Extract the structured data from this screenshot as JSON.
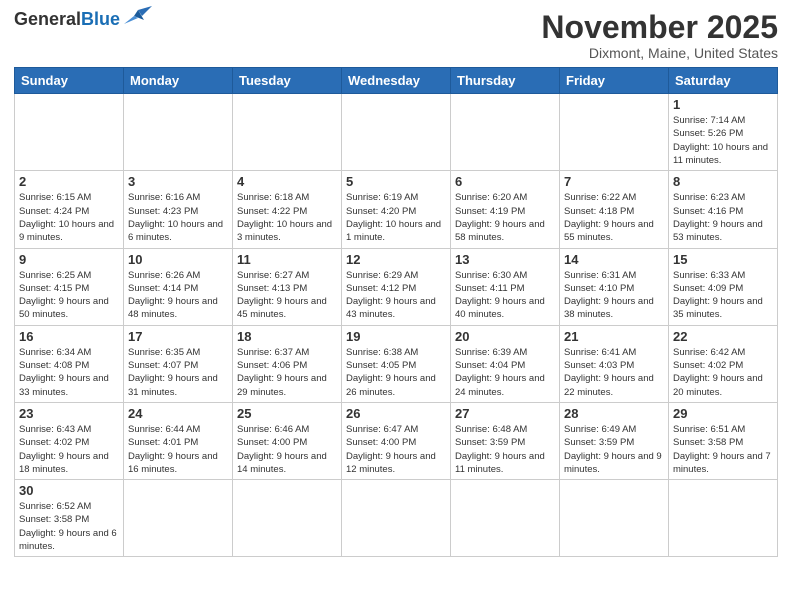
{
  "header": {
    "logo_general": "General",
    "logo_blue": "Blue",
    "month_title": "November 2025",
    "location": "Dixmont, Maine, United States"
  },
  "weekdays": [
    "Sunday",
    "Monday",
    "Tuesday",
    "Wednesday",
    "Thursday",
    "Friday",
    "Saturday"
  ],
  "days": [
    {
      "date": "",
      "info": ""
    },
    {
      "date": "",
      "info": ""
    },
    {
      "date": "",
      "info": ""
    },
    {
      "date": "",
      "info": ""
    },
    {
      "date": "",
      "info": ""
    },
    {
      "date": "",
      "info": ""
    },
    {
      "date": "1",
      "info": "Sunrise: 7:14 AM\nSunset: 5:26 PM\nDaylight: 10 hours and 11 minutes."
    },
    {
      "date": "2",
      "info": "Sunrise: 6:15 AM\nSunset: 4:24 PM\nDaylight: 10 hours and 9 minutes."
    },
    {
      "date": "3",
      "info": "Sunrise: 6:16 AM\nSunset: 4:23 PM\nDaylight: 10 hours and 6 minutes."
    },
    {
      "date": "4",
      "info": "Sunrise: 6:18 AM\nSunset: 4:22 PM\nDaylight: 10 hours and 3 minutes."
    },
    {
      "date": "5",
      "info": "Sunrise: 6:19 AM\nSunset: 4:20 PM\nDaylight: 10 hours and 1 minute."
    },
    {
      "date": "6",
      "info": "Sunrise: 6:20 AM\nSunset: 4:19 PM\nDaylight: 9 hours and 58 minutes."
    },
    {
      "date": "7",
      "info": "Sunrise: 6:22 AM\nSunset: 4:18 PM\nDaylight: 9 hours and 55 minutes."
    },
    {
      "date": "8",
      "info": "Sunrise: 6:23 AM\nSunset: 4:16 PM\nDaylight: 9 hours and 53 minutes."
    },
    {
      "date": "9",
      "info": "Sunrise: 6:25 AM\nSunset: 4:15 PM\nDaylight: 9 hours and 50 minutes."
    },
    {
      "date": "10",
      "info": "Sunrise: 6:26 AM\nSunset: 4:14 PM\nDaylight: 9 hours and 48 minutes."
    },
    {
      "date": "11",
      "info": "Sunrise: 6:27 AM\nSunset: 4:13 PM\nDaylight: 9 hours and 45 minutes."
    },
    {
      "date": "12",
      "info": "Sunrise: 6:29 AM\nSunset: 4:12 PM\nDaylight: 9 hours and 43 minutes."
    },
    {
      "date": "13",
      "info": "Sunrise: 6:30 AM\nSunset: 4:11 PM\nDaylight: 9 hours and 40 minutes."
    },
    {
      "date": "14",
      "info": "Sunrise: 6:31 AM\nSunset: 4:10 PM\nDaylight: 9 hours and 38 minutes."
    },
    {
      "date": "15",
      "info": "Sunrise: 6:33 AM\nSunset: 4:09 PM\nDaylight: 9 hours and 35 minutes."
    },
    {
      "date": "16",
      "info": "Sunrise: 6:34 AM\nSunset: 4:08 PM\nDaylight: 9 hours and 33 minutes."
    },
    {
      "date": "17",
      "info": "Sunrise: 6:35 AM\nSunset: 4:07 PM\nDaylight: 9 hours and 31 minutes."
    },
    {
      "date": "18",
      "info": "Sunrise: 6:37 AM\nSunset: 4:06 PM\nDaylight: 9 hours and 29 minutes."
    },
    {
      "date": "19",
      "info": "Sunrise: 6:38 AM\nSunset: 4:05 PM\nDaylight: 9 hours and 26 minutes."
    },
    {
      "date": "20",
      "info": "Sunrise: 6:39 AM\nSunset: 4:04 PM\nDaylight: 9 hours and 24 minutes."
    },
    {
      "date": "21",
      "info": "Sunrise: 6:41 AM\nSunset: 4:03 PM\nDaylight: 9 hours and 22 minutes."
    },
    {
      "date": "22",
      "info": "Sunrise: 6:42 AM\nSunset: 4:02 PM\nDaylight: 9 hours and 20 minutes."
    },
    {
      "date": "23",
      "info": "Sunrise: 6:43 AM\nSunset: 4:02 PM\nDaylight: 9 hours and 18 minutes."
    },
    {
      "date": "24",
      "info": "Sunrise: 6:44 AM\nSunset: 4:01 PM\nDaylight: 9 hours and 16 minutes."
    },
    {
      "date": "25",
      "info": "Sunrise: 6:46 AM\nSunset: 4:00 PM\nDaylight: 9 hours and 14 minutes."
    },
    {
      "date": "26",
      "info": "Sunrise: 6:47 AM\nSunset: 4:00 PM\nDaylight: 9 hours and 12 minutes."
    },
    {
      "date": "27",
      "info": "Sunrise: 6:48 AM\nSunset: 3:59 PM\nDaylight: 9 hours and 11 minutes."
    },
    {
      "date": "28",
      "info": "Sunrise: 6:49 AM\nSunset: 3:59 PM\nDaylight: 9 hours and 9 minutes."
    },
    {
      "date": "29",
      "info": "Sunrise: 6:51 AM\nSunset: 3:58 PM\nDaylight: 9 hours and 7 minutes."
    },
    {
      "date": "30",
      "info": "Sunrise: 6:52 AM\nSunset: 3:58 PM\nDaylight: 9 hours and 6 minutes."
    },
    {
      "date": "",
      "info": ""
    },
    {
      "date": "",
      "info": ""
    },
    {
      "date": "",
      "info": ""
    },
    {
      "date": "",
      "info": ""
    },
    {
      "date": "",
      "info": ""
    },
    {
      "date": "",
      "info": ""
    }
  ]
}
